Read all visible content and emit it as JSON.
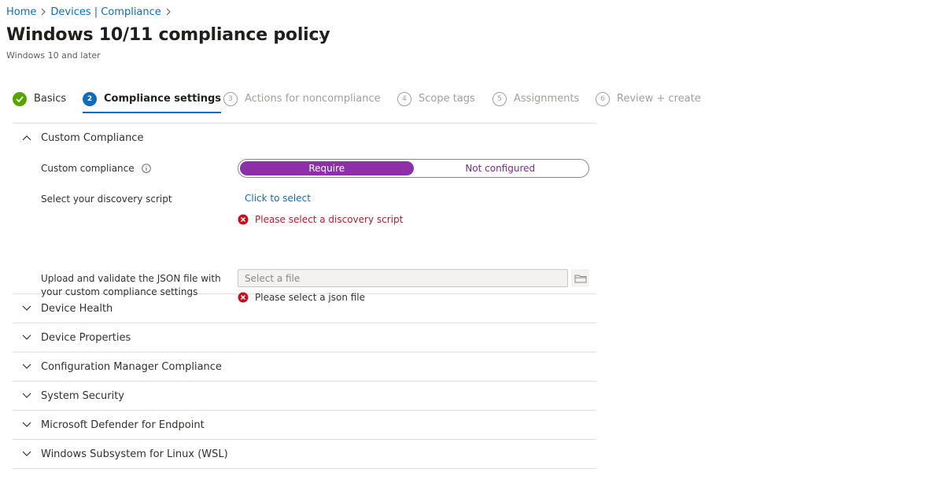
{
  "breadcrumb": [
    {
      "label": "Home"
    },
    {
      "label": "Devices | Compliance"
    }
  ],
  "page": {
    "title": "Windows 10/11 compliance policy",
    "more_label": "···",
    "subtitle": "Windows 10 and later"
  },
  "wizard": {
    "steps": [
      {
        "number": "1",
        "label": "Basics",
        "state": "done"
      },
      {
        "number": "2",
        "label": "Compliance settings",
        "state": "current"
      },
      {
        "number": "3",
        "label": "Actions for noncompliance",
        "state": "pending"
      },
      {
        "number": "4",
        "label": "Scope tags",
        "state": "pending"
      },
      {
        "number": "5",
        "label": "Assignments",
        "state": "pending"
      },
      {
        "number": "6",
        "label": "Review + create",
        "state": "pending"
      }
    ]
  },
  "custom_compliance": {
    "title": "Custom Compliance",
    "custom_compliance_label": "Custom compliance",
    "toggle": {
      "option_on": "Require",
      "option_off": "Not configured",
      "selected": "Require"
    },
    "discovery_label": "Select your discovery script",
    "discovery_link": "Click to select",
    "discovery_error": "Please select a discovery script",
    "json_label_line1": "Upload and validate the JSON file with",
    "json_label_line2": "your custom compliance settings",
    "json_placeholder": "Select a file",
    "json_error": "Please select a json file"
  },
  "sections": [
    {
      "title": "Device Health"
    },
    {
      "title": "Device Properties"
    },
    {
      "title": "Configuration Manager Compliance"
    },
    {
      "title": "System Security"
    },
    {
      "title": "Microsoft Defender for Endpoint"
    },
    {
      "title": "Windows Subsystem for Linux (WSL)"
    }
  ],
  "colors": {
    "link": "#0f6cbd",
    "accent_purple": "#8c2fa8",
    "success_green": "#57a300",
    "error_red": "#c50f1f"
  }
}
